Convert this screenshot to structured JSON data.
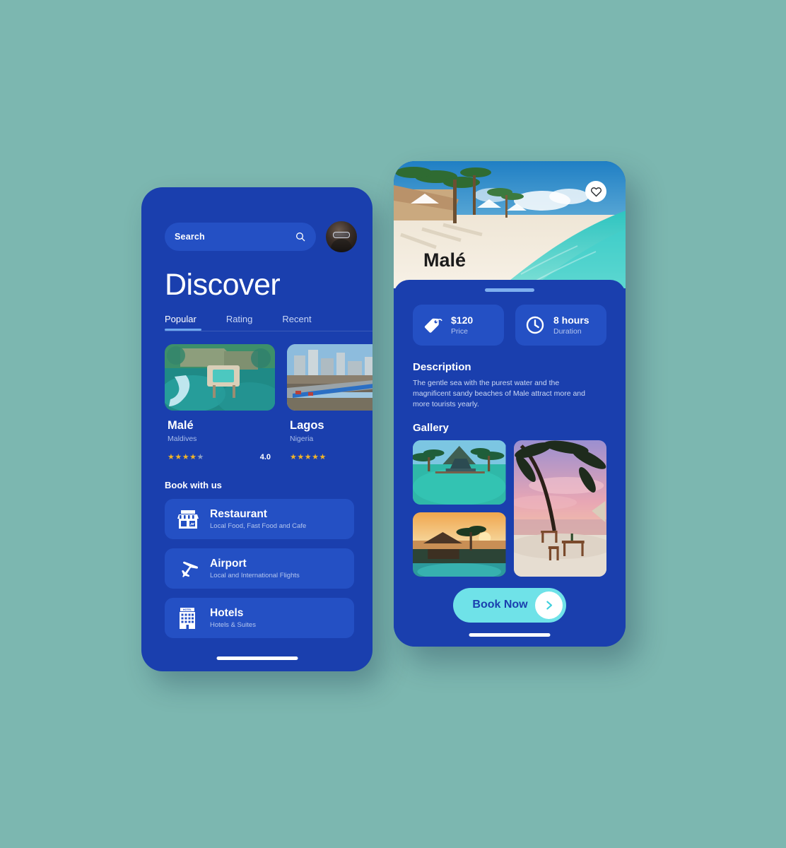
{
  "canvas": {
    "background_color": "#7cb7b0"
  },
  "discover_screen": {
    "search": {
      "placeholder": "Search",
      "icon": "search-icon"
    },
    "avatar": {
      "icon": "user-avatar"
    },
    "title": "Discover",
    "tabs": [
      {
        "label": "Popular",
        "active": true
      },
      {
        "label": "Rating",
        "active": false
      },
      {
        "label": "Recent",
        "active": false
      }
    ],
    "destination_cards": [
      {
        "name": "Malé",
        "country": "Maldives",
        "stars_filled": 4,
        "stars_total": 5,
        "rating": "4.0",
        "image": "overwater-villa-aerial"
      },
      {
        "name": "Lagos",
        "country": "Nigeria",
        "stars_filled": 5,
        "stars_total": 5,
        "rating": "",
        "image": "lagos-cityscape-highway"
      }
    ],
    "book_section_title": "Book with us",
    "services": [
      {
        "title": "Restaurant",
        "subtitle": "Local Food, Fast Food and Cafe",
        "icon": "storefront-icon"
      },
      {
        "title": "Airport",
        "subtitle": "Local and International Flights",
        "icon": "airplane-icon"
      },
      {
        "title": "Hotels",
        "subtitle": "Hotels  & Suites",
        "icon": "hotel-building-icon"
      }
    ]
  },
  "detail_screen": {
    "hero": {
      "title": "Malé",
      "image": "maldives-beach-palms",
      "favorite_icon": "heart-icon"
    },
    "info_chips": [
      {
        "value": "$120",
        "label": "Price",
        "icon": "price-tag-icon"
      },
      {
        "value": "8 hours",
        "label": "Duration",
        "icon": "clock-icon"
      }
    ],
    "description": {
      "heading": "Description",
      "body": "The gentle sea with the purest water and the magnificent sandy beaches of Male attract more and more tourists yearly."
    },
    "gallery": {
      "heading": "Gallery",
      "images": [
        "lagoon-bungalow",
        "sunset-resort-pool",
        "palm-beach-sunset-dining"
      ]
    },
    "cta": {
      "label": "Book Now",
      "icon": "chevron-right-icon"
    }
  },
  "colors": {
    "phone_blue": "#1a3fae",
    "tile_blue": "#2450c4",
    "accent_cyan": "#6fe2e8",
    "star_gold": "#f0b429",
    "tab_underline": "#6ea8f0"
  }
}
